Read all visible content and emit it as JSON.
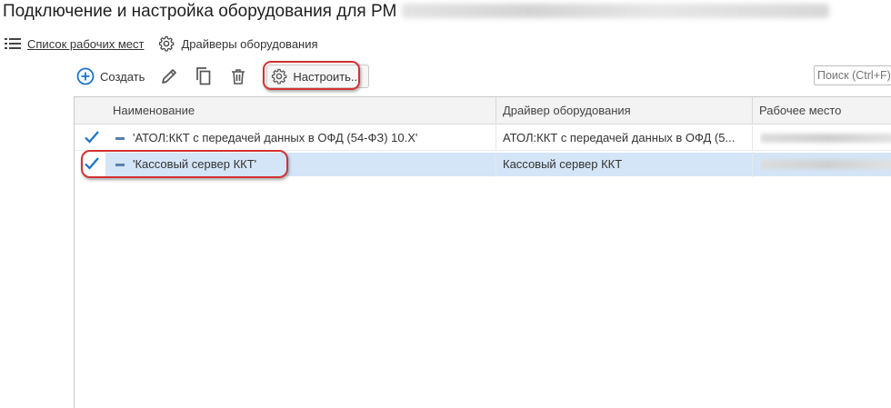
{
  "window": {
    "title": "Подключение и настройка оборудования для РМ"
  },
  "nav": {
    "workplaces_label": "Список рабочих мест",
    "drivers_label": "Драйверы оборудования"
  },
  "toolbar": {
    "create_label": "Создать",
    "configure_label": "Настроить..."
  },
  "search": {
    "placeholder": "Поиск (Ctrl+F)"
  },
  "table": {
    "columns": [
      "Наименование",
      "Драйвер оборудования",
      "Рабочее место"
    ],
    "rows": [
      {
        "name": "'АТОЛ:ККТ с передачей данных в ОФД (54-ФЗ) 10.X'",
        "driver": "АТОЛ:ККТ с передачей данных в ОФД (5...",
        "selected": false
      },
      {
        "name": "'Кассовый сервер ККТ'",
        "driver": "Кассовый сервер ККТ",
        "selected": true
      }
    ]
  },
  "colors": {
    "accent": "#1a73c8",
    "highlight": "#d23232",
    "selection": "#d4e5f7"
  },
  "icons": [
    "list-icon",
    "gear-icon",
    "plus-circle-icon",
    "pencil-icon",
    "copy-icon",
    "trash-icon",
    "check-icon"
  ]
}
